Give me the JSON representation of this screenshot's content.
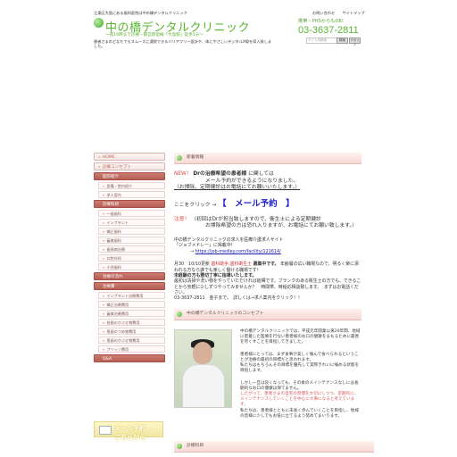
{
  "header": {
    "top_text": "江東区大島にある歯科医院は中の橋デンタルクリニック",
    "title": "中の橋デンタルクリニック",
    "subtitle": "～夜19時まで診療・都営新宿線「大島駅」徒歩1分～",
    "intro": "患者さまのどなたでもスムーズに通院できるバリアフリー設計や、体にやさしいデジタルX線を導入致しました。",
    "top_links": [
      "お問い合わせ",
      "サイトマップ"
    ],
    "phone_label": "携帯・PHSからもOK!",
    "phone": "03-3637-2811",
    "search_placeholder": "サイト内検索",
    "search_button": "検索",
    "reset_button": "リセット"
  },
  "sidebar": {
    "items": [
      {
        "label": "HOME",
        "kind": "menu"
      },
      {
        "label": "診療コンセプト",
        "kind": "menu"
      },
      {
        "label": "医院紹介",
        "kind": "section"
      },
      {
        "label": "設備・院内紹介",
        "kind": "sub"
      },
      {
        "label": "求人案内",
        "kind": "sub"
      },
      {
        "label": "診療科目",
        "kind": "section"
      },
      {
        "label": "一般歯科",
        "kind": "sub"
      },
      {
        "label": "インプラント",
        "kind": "sub"
      },
      {
        "label": "矯正歯科",
        "kind": "sub"
      },
      {
        "label": "審美歯科",
        "kind": "sub"
      },
      {
        "label": "歯周病治療",
        "kind": "sub"
      },
      {
        "label": "口腔外科",
        "kind": "sub"
      },
      {
        "label": "小児歯科",
        "kind": "sub"
      },
      {
        "label": "治療の流れ",
        "kind": "section"
      },
      {
        "label": "治療費",
        "kind": "section"
      },
      {
        "label": "インプラント治療費用",
        "kind": "sub"
      },
      {
        "label": "矯正治療費用",
        "kind": "sub"
      },
      {
        "label": "審美治療費用",
        "kind": "sub"
      },
      {
        "label": "前歯のかぶせ物費用",
        "kind": "sub"
      },
      {
        "label": "奥歯のつめ物費用",
        "kind": "sub"
      },
      {
        "label": "奥歯のかぶせ物費用",
        "kind": "sub"
      },
      {
        "label": "ブリッジ費用",
        "kind": "sub"
      },
      {
        "label": "Q&A",
        "kind": "section"
      }
    ],
    "mail_banner": {
      "line1": "メール予約",
      "line2": "こちらから"
    }
  },
  "main": {
    "news_heading": "新着情報",
    "news_new": "NEW！",
    "news_head1": "Drの治療希望の患者様",
    "news_head2": "に関しては",
    "news_mail_note": "メール予約ができるようになりました。",
    "news_detail": "（お掃除、定期健診はお電話にてお願いいたします。）",
    "click_here": "ここをクリック",
    "click_arrow": "→",
    "mail_reserve": "【　メール予約　】",
    "notice_label": "注意！",
    "notice_text": "（初回はDrが担当致しますので、衛生士による定期健診",
    "notice_text2": "お掃除希望の方は恐れ入りますが、お電話にてお願い致します。）",
    "staff_intro": "中の橋デンタルクリニックの求人を医療介護求人サイト",
    "staff_site": "「ジョブメドレー」に掲載中！",
    "staff_arrow": "→",
    "staff_url": "https://job-medley.com/facility/121614/",
    "recruit_time": "月30　10/10更新",
    "recruit_job": "歯科助手,歯科衛生士",
    "recruit_open": "募集中です。",
    "recruit_body1": "年齢層の広い職場なので、明るく楽に添われる方なら誰でも楽しく働ける職場です！",
    "recruit_body2": "未経験の方も懇切丁寧に指導いたします。",
    "recruit_body3": "最初は清掃や洗い物をやっていただければ結構です。ブランクのある衛生士の方でも、できることから気軽に少しずつやってみませんか？　時間帯、時給応相談致します。　まずはお電話ください。",
    "recruit_contact": "03-3637-2811　金子まで。　詳しくは→求人案内をクリック！！",
    "concept_heading": "中の橋デンタルクリニックのコンセプト",
    "concept_text": [
      "中の橋デンタルクリニックでは、平成元年開業以来20年間、地域に密着した医療を行ない患者様のお口の健康をまもるために最善を尽くすことを目指してきました。",
      "患者様にとっては、まず食事が美しく噛んで食べられるということが治療の最初の目標だと思われます。",
      "私たちはもちろんその目標を優先して実際きれいに噛める状態を目指します。",
      "しかし一旦は良くなっても、その後のメインテナンスなしには長期的なお口の健康は保てません。",
      "したがって、患者さまの自宅の習慣を大切にしつつ、定期的に、メインテナンスしていくことを中心に大事になると考えています。",
      "私たちは、患者様とともに末長く歩んでいくことを目指し、地域の皆様に少しでもお役に立てるよう努めてまいります。"
    ],
    "bottom_heading": "診療科目"
  }
}
